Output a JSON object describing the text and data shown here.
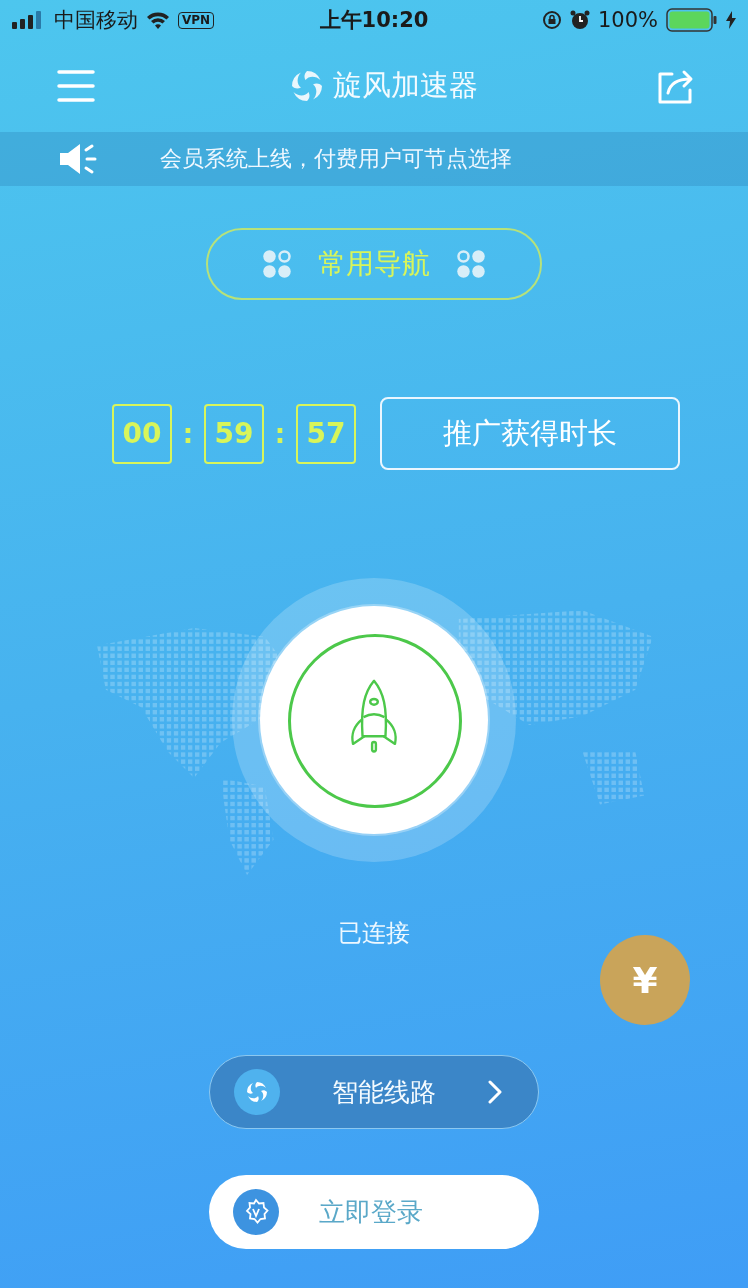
{
  "status_bar": {
    "carrier": "中国移动",
    "vpn": "VPN",
    "time": "上午10:20",
    "battery": "100%"
  },
  "header": {
    "title": "旋风加速器"
  },
  "notice": {
    "text": "会员系统上线，付费用户可节点选择"
  },
  "nav_button": {
    "label": "常用导航"
  },
  "timer": {
    "segments": [
      "00",
      "59",
      "57"
    ],
    "separators": [
      ":",
      ":"
    ]
  },
  "promo_button": {
    "label": "推广获得时长"
  },
  "connection": {
    "connected": true,
    "status": "已连接"
  },
  "pay_button": {
    "label": "¥"
  },
  "route_button": {
    "label": "智能线路"
  },
  "login_button": {
    "label": "立即登录"
  }
}
